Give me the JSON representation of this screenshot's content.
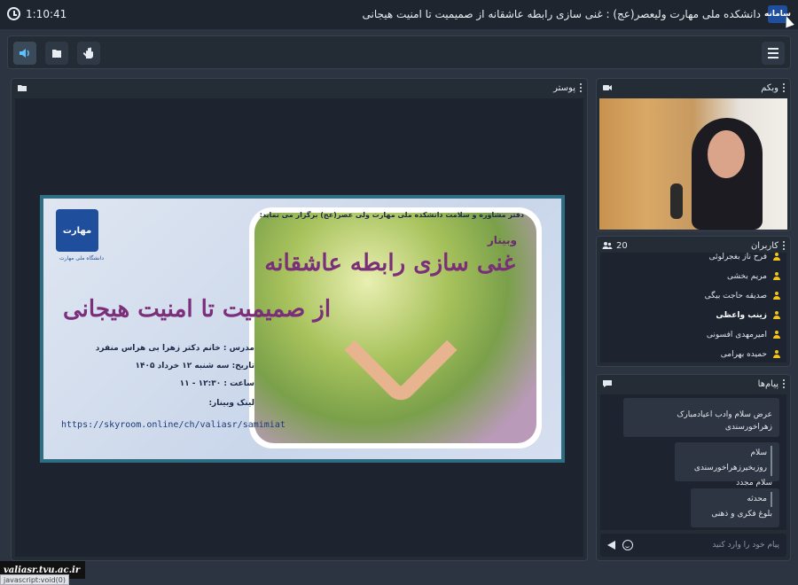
{
  "header": {
    "timer": "1:10:41",
    "title": "دانشکده ملی مهارت ولیعصر(عج) : غنی سازی رابطه عاشقانه از صمیمیت تا امنیت هیجانی",
    "logo_text": "سامانه"
  },
  "toolbar": {
    "buttons": [
      "speaker-icon",
      "file-icon",
      "hand-icon"
    ],
    "menu": "menu-icon"
  },
  "poster_panel": {
    "title": "پوستر"
  },
  "poster": {
    "top_line": "دفتر مشاوره و سلامت دانشکده ملی مهارت ولی عصر(عج) برگزار می نماید:",
    "webinar": "وبینار",
    "title_1": "غنی سازی رابطه عاشقانه",
    "title_2": "از صمیمیت تا امنیت هیجانی",
    "teacher": "مدرس : خانم دکتر زهرا بی هراس منفرد",
    "date": "تاریخ: سه شنبه ۱۲ خرداد ۱۴۰۵",
    "time": "ساعت : ۱۲:۳۰ - ۱۱",
    "link_label": "لینک وبینار:",
    "link": "https://skyroom.online/ch/valiasr/samimiat",
    "logo_text": "مهارت",
    "logo_caption": "دانشگاه ملی مهارت"
  },
  "webcam_panel": {
    "title": "وبکم"
  },
  "users_panel": {
    "title": "کاربران",
    "count": "20",
    "users": [
      {
        "name": "فرح ناز بغجرلوئی",
        "bold": false
      },
      {
        "name": "مریم بخشی",
        "bold": false
      },
      {
        "name": "صدیقه حاجت بیگی",
        "bold": false
      },
      {
        "name": "زینب واعظی",
        "bold": true
      },
      {
        "name": "امیرمهدی افسونی",
        "bold": false
      },
      {
        "name": "حمیده بهرامی",
        "bold": false
      }
    ]
  },
  "messages_panel": {
    "title": "پیام‌ها",
    "messages": [
      {
        "lines": [
          "عرض سلام وادب اعیادمبارک زهراخورسندی"
        ]
      },
      {
        "name": "سلام روزبخیرزهراخورسندی",
        "lines": [
          "سلام مجدد"
        ]
      },
      {
        "name": "محدثه",
        "lines": [
          "بلوغ فکری و ذهنی"
        ]
      }
    ],
    "input_placeholder": "پیام خود را وارد کنید"
  },
  "footer": {
    "watermark": "valiasr.tvu.ac.ir",
    "status": "javascript:void(0)"
  },
  "colors": {
    "background": "#2b3440",
    "accent_yellow": "#f0c419",
    "poster_border": "#2d6e82"
  }
}
